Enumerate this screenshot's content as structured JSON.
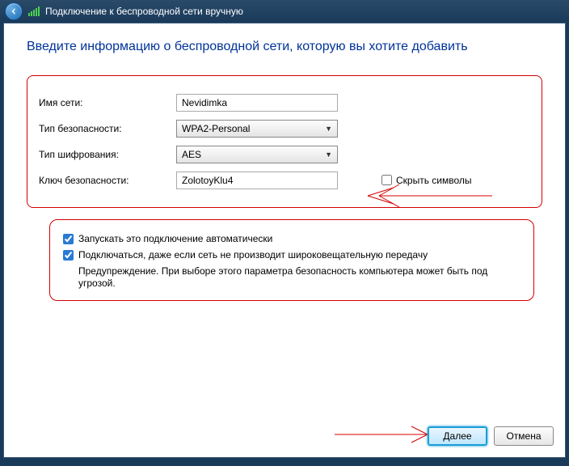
{
  "titlebar": {
    "title": "Подключение к беспроводной сети вручную"
  },
  "heading": "Введите информацию о беспроводной сети, которую вы хотите добавить",
  "form": {
    "ssid_label": "Имя сети:",
    "ssid_value": "Nevidimka",
    "security_label": "Тип безопасности:",
    "security_value": "WPA2-Personal",
    "encryption_label": "Тип шифрования:",
    "encryption_value": "AES",
    "key_label": "Ключ безопасности:",
    "key_value": "ZolotoyKlu4",
    "hide_chars_label": "Скрыть символы"
  },
  "options": {
    "auto_connect_label": "Запускать это подключение автоматически",
    "auto_connect_checked": true,
    "connect_hidden_label": "Подключаться, даже если сеть не производит широковещательную передачу",
    "connect_hidden_checked": true,
    "warning": "Предупреждение. При выборе этого параметра безопасность компьютера может быть под угрозой."
  },
  "buttons": {
    "next": "Далее",
    "cancel": "Отмена"
  }
}
